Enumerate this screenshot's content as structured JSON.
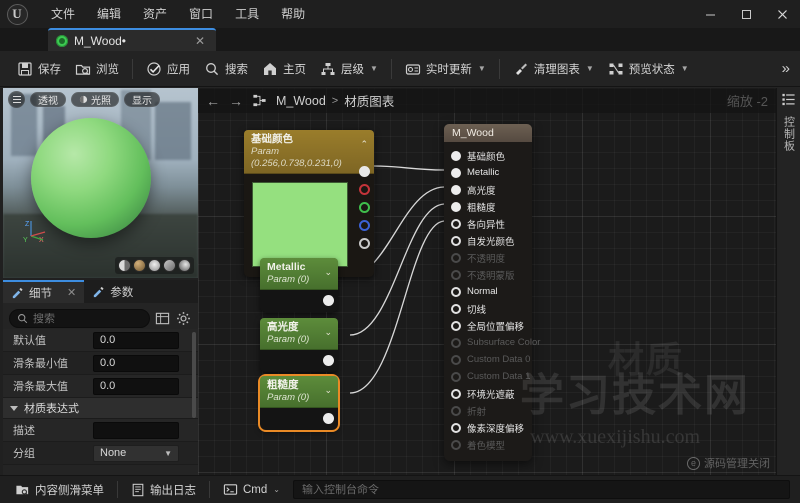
{
  "window": {
    "menu": [
      "文件",
      "编辑",
      "资产",
      "窗口",
      "工具",
      "帮助"
    ],
    "controls": {
      "minimize": "—",
      "maximize": "▢",
      "close": "✕"
    },
    "logo": "U"
  },
  "tab": {
    "label": "M_Wood•",
    "close": "✕",
    "icon": "material-sphere-icon"
  },
  "toolbar": {
    "buttons": [
      {
        "label": "保存",
        "icon": "save-icon",
        "caret": false
      },
      {
        "label": "浏览",
        "icon": "browse-icon",
        "caret": false
      },
      {
        "label": "应用",
        "icon": "apply-check-icon",
        "caret": false
      },
      {
        "label": "搜索",
        "icon": "search-icon",
        "caret": false
      },
      {
        "label": "主页",
        "icon": "home-icon",
        "caret": false
      },
      {
        "label": "层级",
        "icon": "hierarchy-icon",
        "caret": true
      },
      {
        "label": "实时更新",
        "icon": "live-update-icon",
        "caret": true
      },
      {
        "label": "清理图表",
        "icon": "clean-graph-icon",
        "caret": true
      },
      {
        "label": "预览状态",
        "icon": "preview-state-icon",
        "caret": true
      }
    ],
    "overflow": "»"
  },
  "viewport": {
    "menu_icon": "hamburger-icon",
    "pills": [
      "透视",
      "光照",
      "显示"
    ],
    "axis": {
      "z": "Z",
      "y": "Y",
      "x": "X"
    },
    "preview_shapes": [
      "plane",
      "sphere",
      "cylinder",
      "cube",
      "custom"
    ]
  },
  "details": {
    "tabs": [
      {
        "label": "细节",
        "active": true,
        "closable": true,
        "close": "✕"
      },
      {
        "label": "参数",
        "active": false,
        "closable": false
      }
    ],
    "search_placeholder": "搜索",
    "search_value": "",
    "grid_icon": "table-view-icon",
    "settings_icon": "gear-icon",
    "rows": [
      {
        "label": "默认值",
        "value": "0.0",
        "type": "number"
      },
      {
        "label": "滑条最小值",
        "value": "0.0",
        "type": "number"
      },
      {
        "label": "滑条最大值",
        "value": "0.0",
        "type": "number"
      }
    ],
    "section": {
      "label": "材质表达式",
      "expanded": true
    },
    "section_rows": [
      {
        "label": "描述",
        "value": "",
        "type": "text"
      },
      {
        "label": "分组",
        "value": "None",
        "type": "select"
      }
    ]
  },
  "graph": {
    "nav_back": "←",
    "nav_forward": "→",
    "breadcrumb_icon": "graph-icon",
    "breadcrumb": [
      "M_Wood",
      "材质图表"
    ],
    "breadcrumb_sep": ">",
    "zoom_label": "缩放 -2"
  },
  "nodes": {
    "base_color": {
      "title": "基础颜色",
      "subtitle": "Param (0.256,0.738,0.231,0)",
      "caret": "⌃",
      "swatch_color": "#95e07f",
      "pins": [
        "RGBA",
        "R",
        "G",
        "B",
        "A"
      ]
    },
    "scalars": [
      {
        "title": "Metallic",
        "subtitle": "Param (0)",
        "caret": "⌄",
        "selected": false
      },
      {
        "title": "高光度",
        "subtitle": "Param (0)",
        "caret": "⌄",
        "selected": false
      },
      {
        "title": "粗糙度",
        "subtitle": "Param (0)",
        "caret": "⌄",
        "selected": true
      }
    ],
    "material": {
      "title": "M_Wood",
      "pins": [
        {
          "label": "基础颜色",
          "enabled": true
        },
        {
          "label": "Metallic",
          "enabled": true
        },
        {
          "label": "高光度",
          "enabled": true
        },
        {
          "label": "粗糙度",
          "enabled": true
        },
        {
          "label": "各向异性",
          "enabled": true
        },
        {
          "label": "自发光颜色",
          "enabled": true
        },
        {
          "label": "不透明度",
          "enabled": false
        },
        {
          "label": "不透明蒙版",
          "enabled": false
        },
        {
          "label": "Normal",
          "enabled": true
        },
        {
          "label": "切线",
          "enabled": true
        },
        {
          "label": "全局位置偏移",
          "enabled": true
        },
        {
          "label": "Subsurface Color",
          "enabled": false
        },
        {
          "label": "Custom Data 0",
          "enabled": false
        },
        {
          "label": "Custom Data 1",
          "enabled": false
        },
        {
          "label": "环境光遮蔽",
          "enabled": true
        },
        {
          "label": "折射",
          "enabled": false
        },
        {
          "label": "像素深度偏移",
          "enabled": true
        },
        {
          "label": "着色模型",
          "enabled": false
        }
      ]
    }
  },
  "watermark": {
    "big": "材质",
    "overlay": "学习技术网",
    "url": "www.xuexijishu.com",
    "badge": "源码管理关闭",
    "badge_icon": "source-control-icon"
  },
  "right_rail": {
    "panel_icon": "palette-list-icon",
    "label": "控制板"
  },
  "statusbar": {
    "content_drawer": "内容侧滑菜单",
    "content_drawer_icon": "drawer-icon",
    "output_log": "输出日志",
    "output_log_icon": "log-icon",
    "cmd_label": "Cmd",
    "cmd_icon": "console-icon",
    "cmd_caret": "⌄",
    "console_placeholder": "输入控制台命令",
    "console_value": ""
  },
  "colors": {
    "accent_blue": "#3d8de0",
    "selected_orange": "#e98a26",
    "param_green": "#5d8c3b",
    "basecolor_gold": "#9a7d2b",
    "swatch": "#95e07f"
  }
}
